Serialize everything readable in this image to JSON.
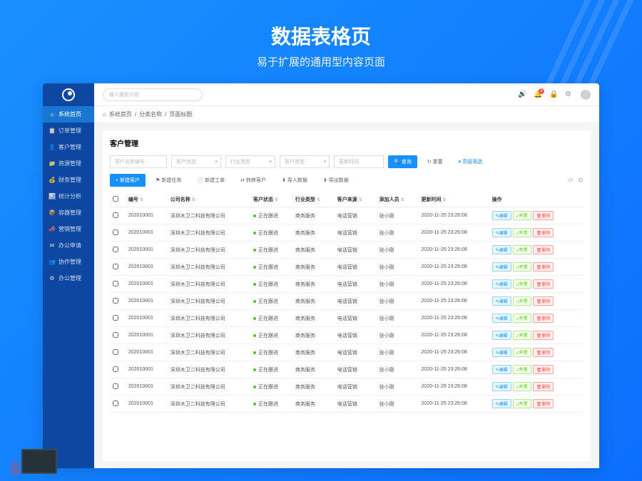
{
  "hero": {
    "title": "数据表格页",
    "subtitle": "易于扩展的通用型内容页面"
  },
  "search": {
    "placeholder": "输入搜索内容"
  },
  "notif_count": "0",
  "breadcrumb": {
    "home": "系统首页",
    "cat": "分类名称",
    "page": "页面标题"
  },
  "sidebar": {
    "items": [
      {
        "icon": "⌂",
        "label": "系统首页"
      },
      {
        "icon": "📋",
        "label": "订单管理"
      },
      {
        "icon": "👤",
        "label": "客户管理"
      },
      {
        "icon": "📁",
        "label": "资源管理"
      },
      {
        "icon": "💰",
        "label": "财务管理"
      },
      {
        "icon": "📊",
        "label": "统计分析"
      },
      {
        "icon": "📦",
        "label": "容器管理"
      },
      {
        "icon": "📣",
        "label": "营销管理"
      },
      {
        "icon": "✉",
        "label": "办公申请"
      },
      {
        "icon": "👥",
        "label": "协作管理"
      },
      {
        "icon": "⚙",
        "label": "办公管理"
      }
    ]
  },
  "panel": {
    "title": "客户管理"
  },
  "filters": {
    "f1": "客户名称编号",
    "f2": "客户状态",
    "f3": "行业类型",
    "f4": "客户类型",
    "f5": "更新时间",
    "search_btn": "查询",
    "reset_btn": "重置",
    "advanced": "高级筛选"
  },
  "toolbar": {
    "new_customer": "新建客户",
    "new_task": "新建任务",
    "new_ticket": "新建工单",
    "transfer": "转移客户",
    "import": "导入数据",
    "export": "导出数据"
  },
  "columns": {
    "id": "编号",
    "company": "公司名称",
    "status": "客户状态",
    "industry": "行业类型",
    "source": "客户来源",
    "adder": "添加人员",
    "updated": "更新时间",
    "actions": "操作"
  },
  "row": {
    "id": "202010001",
    "company": "深圳木卫二科技有限公司",
    "status": "正在跟进",
    "industry": "商务服务",
    "source": "电话营销",
    "adder": "张小刚",
    "updated": "2020-11-25 23:26:08"
  },
  "actions": {
    "edit": "编辑",
    "open": "开票",
    "delete": "删除"
  }
}
